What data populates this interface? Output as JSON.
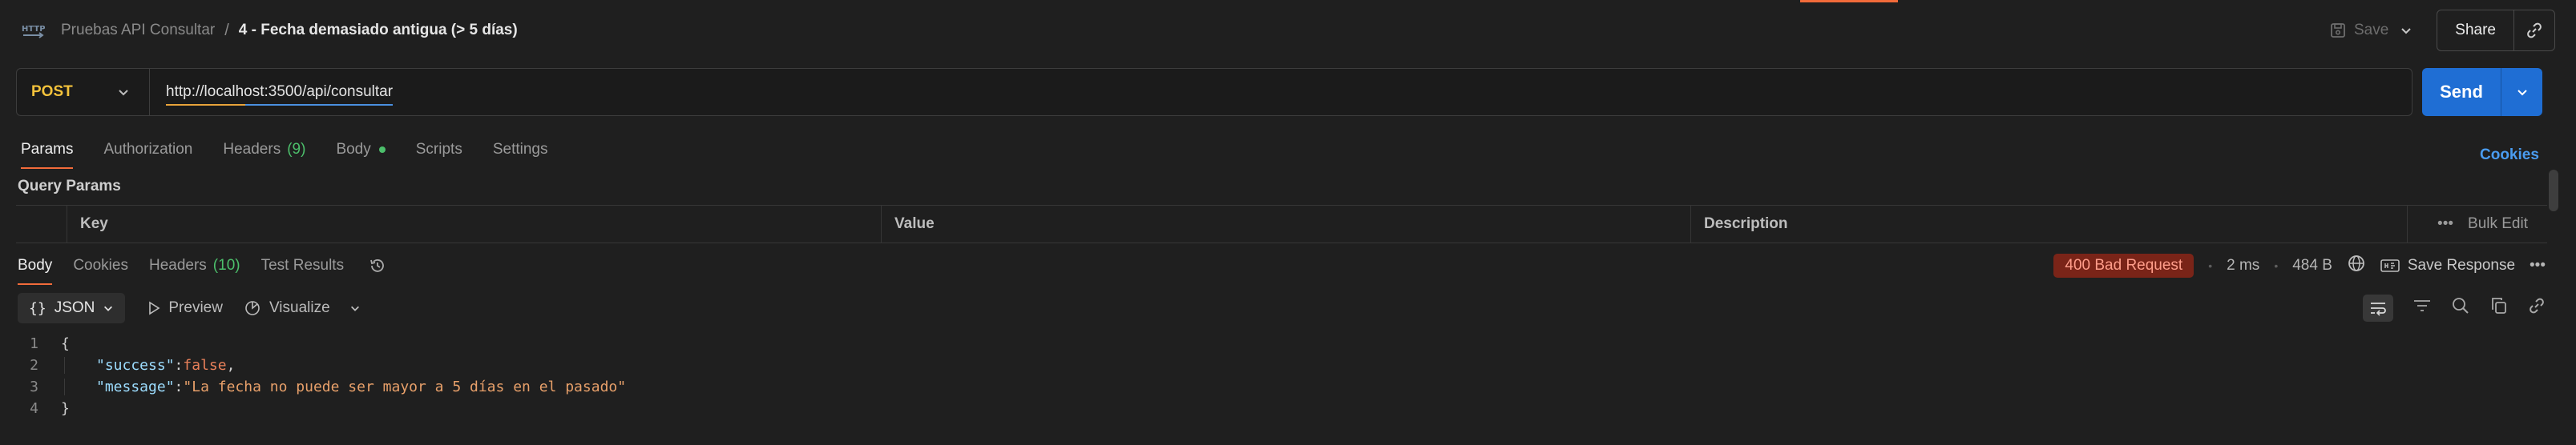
{
  "header": {
    "collection": "Pruebas API Consultar",
    "separator": "/",
    "request_title": "4 - Fecha demasiado antigua (> 5 días)",
    "save_label": "Save",
    "share_label": "Share"
  },
  "request": {
    "method": "POST",
    "url": "http://localhost:3500/api/consultar",
    "send_label": "Send"
  },
  "request_tabs": {
    "params": "Params",
    "authorization": "Authorization",
    "headers": "Headers",
    "headers_count": "(9)",
    "body": "Body",
    "scripts": "Scripts",
    "settings": "Settings",
    "cookies": "Cookies"
  },
  "params": {
    "section_label": "Query Params",
    "columns": [
      "Key",
      "Value",
      "Description"
    ],
    "bulk_edit": "Bulk Edit",
    "more": "•••"
  },
  "response_tabs": {
    "body": "Body",
    "cookies": "Cookies",
    "headers": "Headers",
    "headers_count": "(10)",
    "test_results": "Test Results"
  },
  "response_meta": {
    "status": "400 Bad Request",
    "time": "2 ms",
    "size": "484 B",
    "save_response": "Save Response",
    "dot": "•",
    "more": "•••"
  },
  "response_toolbar": {
    "format": "JSON",
    "braces": "{}",
    "preview": "Preview",
    "visualize": "Visualize"
  },
  "code": {
    "line1": "{",
    "success_key": "\"success\"",
    "success_value": "false",
    "message_key": "\"message\"",
    "message_value": "\"La fecha no puede ser mayor a 5 días en el pasado\"",
    "line4": "}",
    "colon": ": ",
    "comma": ",",
    "ln1": "1",
    "ln2": "2",
    "ln3": "3",
    "ln4": "4"
  },
  "colors": {
    "accent": "#f26b3a",
    "send": "#1f6ed4",
    "method": "#f3c23b",
    "success_count": "#4cbf6b",
    "error_badge": "#7a2418"
  }
}
